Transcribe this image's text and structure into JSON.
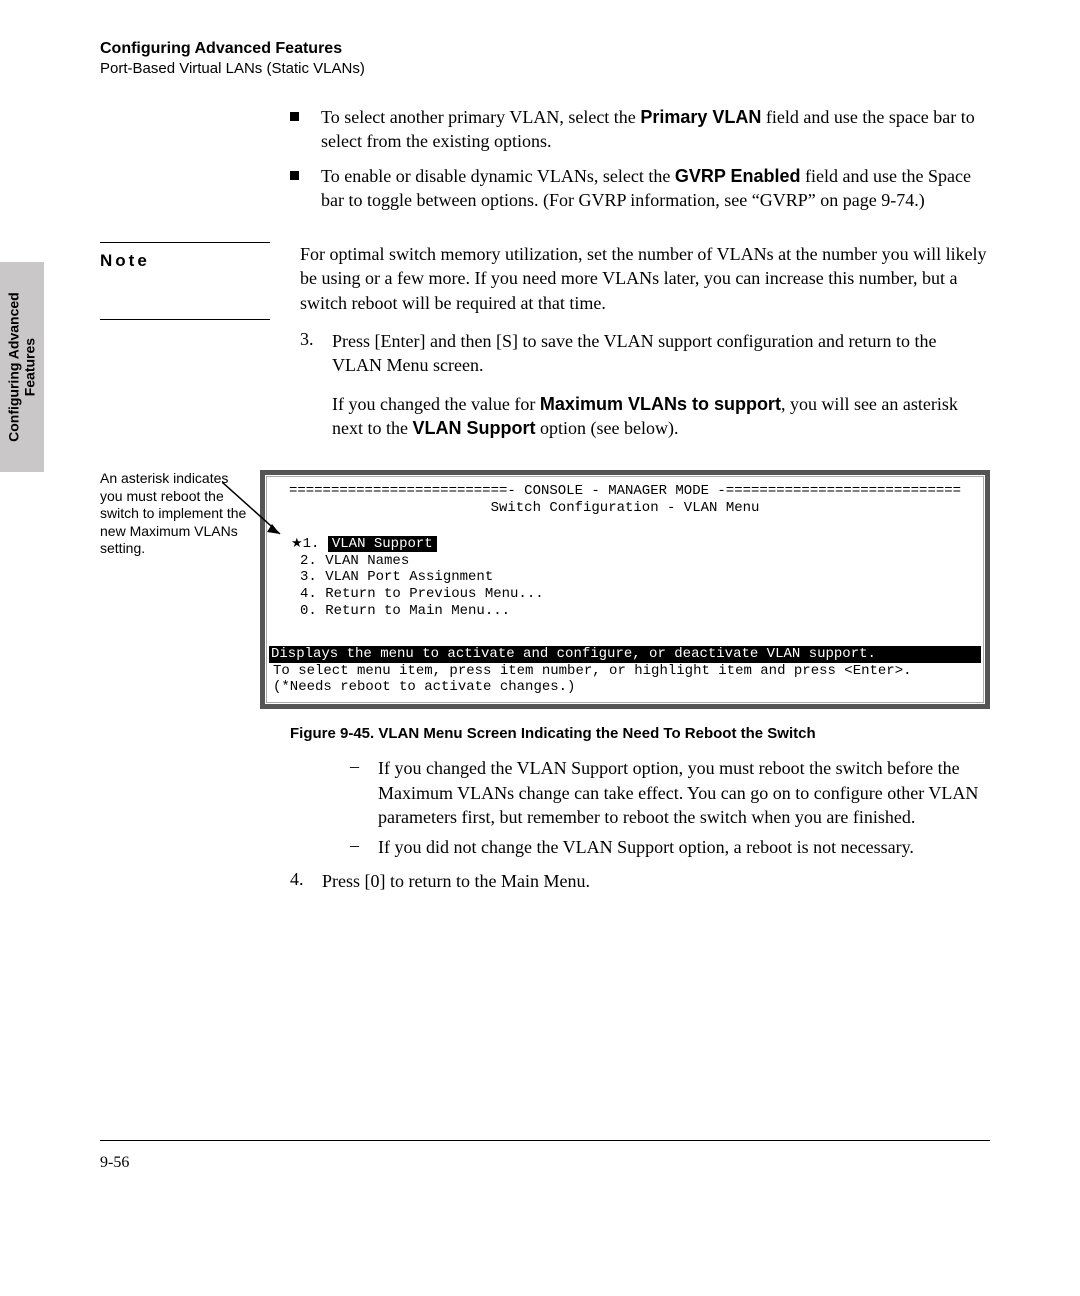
{
  "sideTab": {
    "line1": "Configuring Advanced",
    "line2": "Features"
  },
  "header": {
    "title": "Configuring Advanced Features",
    "subtitle": "Port-Based Virtual LANs (Static VLANs)"
  },
  "bullets": [
    {
      "pre": "To select another primary VLAN, select the ",
      "bold": "Primary VLAN",
      "post": " field and use the space bar to select from the existing options."
    },
    {
      "pre": "To enable or disable dynamic VLANs, select the ",
      "bold": "GVRP Enabled",
      "post": " field and use the Space bar to toggle between options. (For GVRP information, see “GVRP” on page 9-74.)"
    }
  ],
  "note": {
    "label": "Note",
    "body": "For optimal switch memory utilization, set the number of VLANs at the number you will likely be using or a few more. If you need more VLANs later, you can increase this number, but a switch reboot will be required at that time."
  },
  "step3": {
    "num": "3.",
    "line1": "Press [Enter] and then [S] to save the VLAN support configuration and return to the VLAN Menu screen.",
    "line2_pre": "If you changed the value for ",
    "line2_bold1": "Maximum VLANs to support",
    "line2_mid": ", you will see an asterisk next to the ",
    "line2_bold2": "VLAN Support",
    "line2_post": " option (see below)."
  },
  "callout": "An asterisk indicates you must reboot the switch to implement the new Maximum VLANs setting.",
  "console": {
    "header1": "==========================- CONSOLE - MANAGER MODE -============================",
    "header2": "Switch Configuration - VLAN Menu",
    "menu1_prefix": "1.",
    "menu1_text": "VLAN Support",
    "menu2": "2. VLAN Names",
    "menu3": "3. VLAN Port Assignment",
    "menu4": "4. Return to Previous Menu...",
    "menu0": "0. Return to Main Menu...",
    "desc_hl": "Displays the menu to activate and configure, or deactivate VLAN support.",
    "help1": "To select menu item, press item number, or highlight item and press <Enter>.",
    "help2": "(*Needs reboot to activate changes.)"
  },
  "figcap": "Figure 9-45.  VLAN Menu Screen Indicating the Need To Reboot the Switch",
  "dashes": [
    "If you changed the VLAN Support option, you must reboot the switch before the Maximum VLANs change can take effect. You can go on to configure other VLAN parameters first, but remember to reboot the switch when you are finished.",
    "If you did not change the VLAN Support option, a reboot is not necessary."
  ],
  "step4": {
    "num": "4.",
    "text": "Press [0] to return to the Main Menu."
  },
  "pageNum": "9-56"
}
